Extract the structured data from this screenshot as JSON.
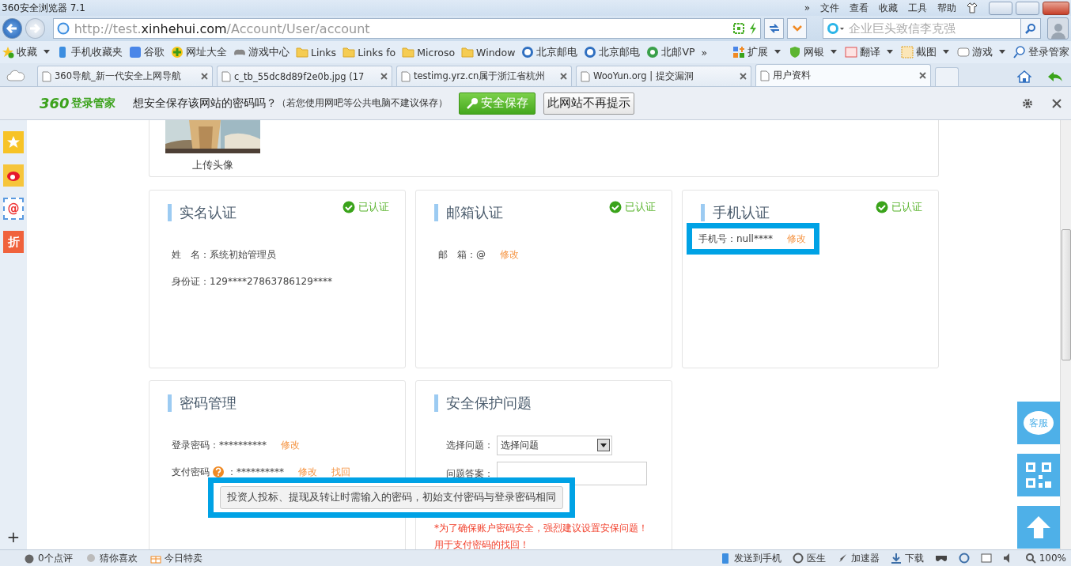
{
  "window": {
    "title": "360安全浏览器 7.1",
    "menu": [
      "»",
      "文件",
      "查看",
      "收藏",
      "工具",
      "帮助"
    ]
  },
  "address_bar": {
    "url": "http://test.**xinhehui.com**/Account/User/account"
  },
  "search": {
    "placeholder": "企业巨头致信李克强"
  },
  "bookmarks": [
    {
      "kind": "menu",
      "label": "收藏"
    },
    {
      "kind": "site",
      "label": "手机收藏夹"
    },
    {
      "kind": "site",
      "label": "谷歌"
    },
    {
      "kind": "site",
      "label": "网址大全"
    },
    {
      "kind": "site",
      "label": "游戏中心"
    },
    {
      "kind": "folder",
      "label": "Links"
    },
    {
      "kind": "folder",
      "label": "Links fo"
    },
    {
      "kind": "folder",
      "label": "Microso"
    },
    {
      "kind": "folder",
      "label": "Window"
    },
    {
      "kind": "site",
      "label": "北京邮电"
    },
    {
      "kind": "site",
      "label": "北京邮电"
    },
    {
      "kind": "site",
      "label": "北邮VP"
    },
    {
      "kind": "more",
      "label": "»"
    }
  ],
  "tools": [
    {
      "label": "扩展",
      "dropdown": true
    },
    {
      "label": "网银",
      "dropdown": true
    },
    {
      "label": "翻译",
      "dropdown": true
    },
    {
      "label": "截图",
      "dropdown": true
    },
    {
      "label": "游戏",
      "dropdown": true
    },
    {
      "label": "登录管家",
      "dropdown": false
    }
  ],
  "tabs": [
    {
      "label": "360导航_新一代安全上网导航",
      "selected": false
    },
    {
      "label": "c_tb_55dc8d89f2e0b.jpg (17",
      "selected": false
    },
    {
      "label": "testimg.yrz.cn属于浙江省杭州",
      "selected": false
    },
    {
      "label": "WooYun.org | 提交漏洞",
      "selected": false
    },
    {
      "label": "用户资料",
      "selected": true
    }
  ],
  "password_bar": {
    "brand": "360",
    "product": "登录管家",
    "question": "想安全保存该网站的密码吗？",
    "hint": "（若您使用网吧等公共电脑不建议保存）",
    "buttons": [
      {
        "kind": "primary",
        "label": "安全保存"
      },
      {
        "kind": "plain",
        "label": "此网站不再提示"
      }
    ]
  },
  "sidebar": {
    "items": [
      {
        "kind": "star"
      },
      {
        "kind": "weibo"
      },
      {
        "kind": "mail",
        "label": "@"
      },
      {
        "kind": "deal",
        "label": "折"
      }
    ],
    "add": "+"
  },
  "avatar": {
    "caption": "上传头像"
  },
  "cards": [
    {
      "title": "实名认证",
      "verified": true,
      "status": "已认证",
      "rows": [
        {
          "kind": "text",
          "label": "姓　名：系统初始管理员"
        },
        {
          "kind": "text",
          "label": "身份证：129****27863786129****"
        }
      ]
    },
    {
      "title": "邮箱认证",
      "verified": true,
      "status": "已认证",
      "rows": [
        {
          "kind": "text",
          "label": "邮　箱：@",
          "actions": [
            "修改"
          ]
        }
      ]
    },
    {
      "title": "手机认证",
      "verified": true,
      "status": "已认证",
      "rows": [
        {
          "kind": "text",
          "label": "手机号：null****",
          "actions": [
            "修改"
          ],
          "highlighted": true
        }
      ]
    },
    {
      "title": "密码管理",
      "verified": false,
      "rows": [
        {
          "kind": "text",
          "label": "登录密码：**********",
          "actions": [
            "修改"
          ]
        },
        {
          "kind": "text",
          "label": "支付密码",
          "help": true,
          "value": "：**********",
          "actions": [
            "修改",
            "找回"
          ]
        }
      ]
    },
    {
      "title": "安全保护问题",
      "verified": false,
      "rows": [
        {
          "kind": "select",
          "label": "选择问题：",
          "value": "选择问题"
        },
        {
          "kind": "input",
          "label": "问题答案："
        }
      ],
      "notes": [
        "*为了确保账户密码安全，强烈建议设置安保问题！",
        "用于支付密码的找回！"
      ]
    }
  ],
  "tooltip": {
    "text": "投资人投标、提现及转让时需输入的密码，初始支付密码与登录密码相同",
    "highlighted": true
  },
  "side_tools": [
    {
      "kind": "chat",
      "label": "客服"
    },
    {
      "kind": "qr"
    },
    {
      "kind": "top"
    }
  ],
  "status_bar": {
    "left": [
      "0个点评",
      "猜你喜欢",
      "今日特卖"
    ],
    "right": [
      "发送到手机",
      "医生",
      "加速器",
      "下载"
    ],
    "zoom": "100%"
  }
}
